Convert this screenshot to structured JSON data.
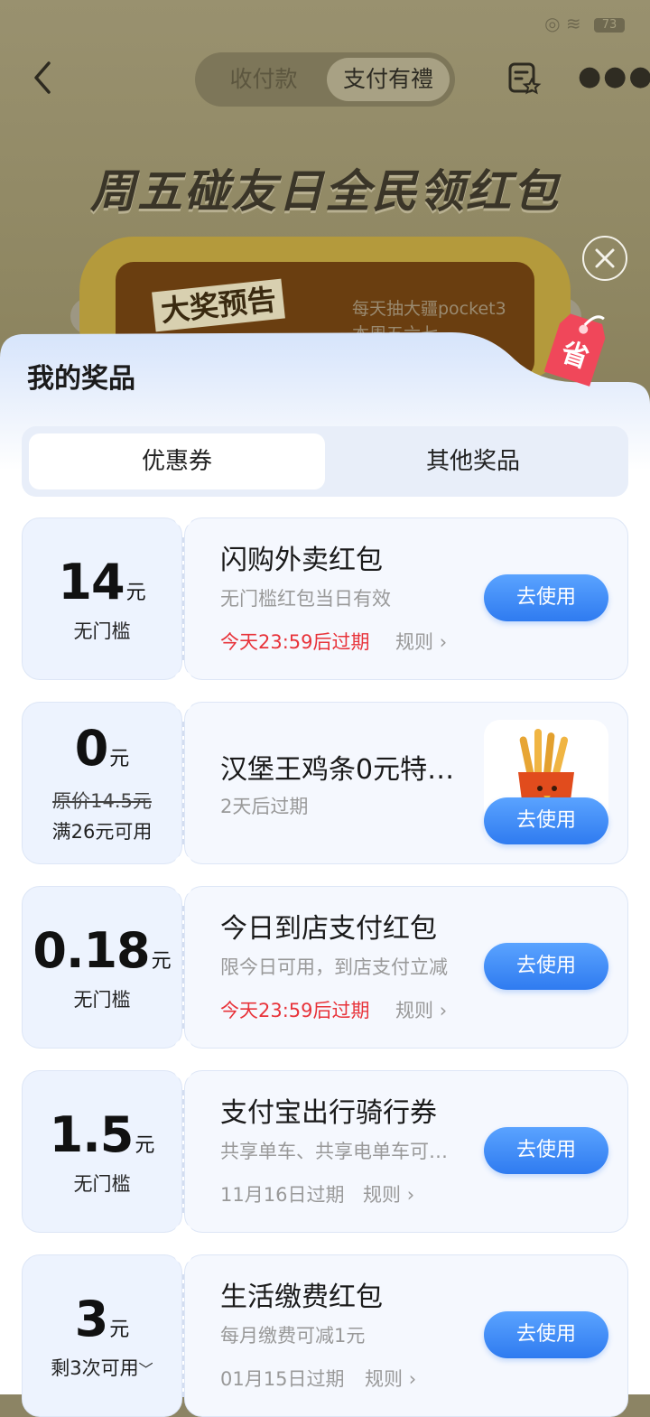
{
  "status_bar": {
    "left_text": "",
    "battery": "73"
  },
  "header": {
    "segments": [
      {
        "label": "收付款"
      },
      {
        "label": "支付有禮"
      }
    ]
  },
  "promo": {
    "title": "周五碰友日全民领红包",
    "board_tag": "大奖预告",
    "board_lines": [
      "每天抽大疆pocket3",
      "本周五六七"
    ]
  },
  "sheet": {
    "title": "我的奖品",
    "tabs": [
      {
        "label": "优惠券"
      },
      {
        "label": "其他奖品"
      }
    ]
  },
  "coupons": [
    {
      "amount": "14",
      "unit": "元",
      "condition": "无门槛",
      "title": "闪购外卖红包",
      "desc": "无门槛红包当日有效",
      "expiry": "今天23:59后过期",
      "rules": "规则",
      "button": "去使用"
    },
    {
      "amount": "0",
      "unit": "元",
      "original_price": "原价14.5元",
      "condition": "满26元可用",
      "title": "汉堡王鸡条0元特…",
      "desc": "",
      "expiry": "2天后过期",
      "rules": "",
      "button": "去使用",
      "thumbnail": "fries-image"
    },
    {
      "amount": "0.18",
      "unit": "元",
      "condition": "无门槛",
      "title": "今日到店支付红包",
      "desc": "限今日可用，到店支付立减",
      "expiry": "今天23:59后过期",
      "rules": "规则",
      "button": "去使用"
    },
    {
      "amount": "1.5",
      "unit": "元",
      "condition": "无门槛",
      "title": "支付宝出行骑行券",
      "desc": "共享单车、共享电单车可…",
      "expiry": "11月16日过期",
      "rules": "规则",
      "button": "去使用"
    },
    {
      "amount": "3",
      "unit": "元",
      "condition": "剩3次可用",
      "title": "生活缴费红包",
      "desc": "每月缴费可减1元",
      "expiry": "01月15日过期",
      "rules": "规则",
      "button": "去使用"
    }
  ],
  "colors": {
    "accent_blue": "#2f7bf0",
    "expiry_red": "#e8333a"
  }
}
